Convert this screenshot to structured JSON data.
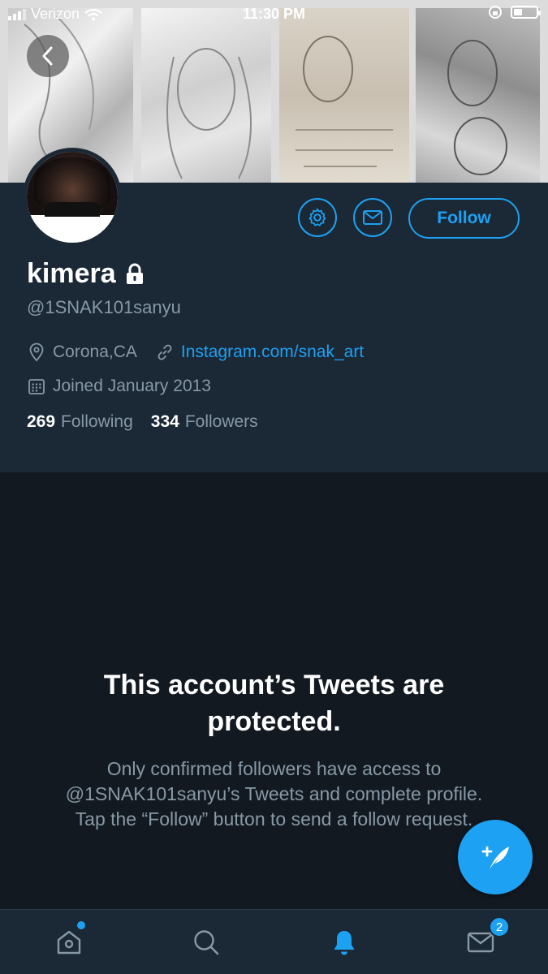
{
  "status_bar": {
    "carrier": "Verizon",
    "time": "11:30 PM"
  },
  "profile": {
    "name": "kimera",
    "handle": "@1SNAK101sanyu",
    "location": "Corona,CA",
    "website": "Instagram.com/snak_art",
    "joined": "Joined January 2013",
    "following_count": "269",
    "following_label": "Following",
    "followers_count": "334",
    "followers_label": "Followers",
    "follow_button": "Follow"
  },
  "protected": {
    "title": "This account’s Tweets are protected.",
    "body": "Only confirmed followers have access to @1SNAK101sanyu’s Tweets and complete profile. Tap the “Follow” button to send a follow request."
  },
  "tab_bar": {
    "items": [
      {
        "name": "home",
        "icon": "home-icon"
      },
      {
        "name": "search",
        "icon": "search-icon"
      },
      {
        "name": "notifications",
        "icon": "bell-icon",
        "active": true
      },
      {
        "name": "messages",
        "icon": "mail-icon",
        "badge": "2"
      }
    ]
  },
  "colors": {
    "accent": "#1da1f2",
    "header_bg": "#1b2836",
    "body_bg": "#131920",
    "muted": "#8899a6"
  }
}
